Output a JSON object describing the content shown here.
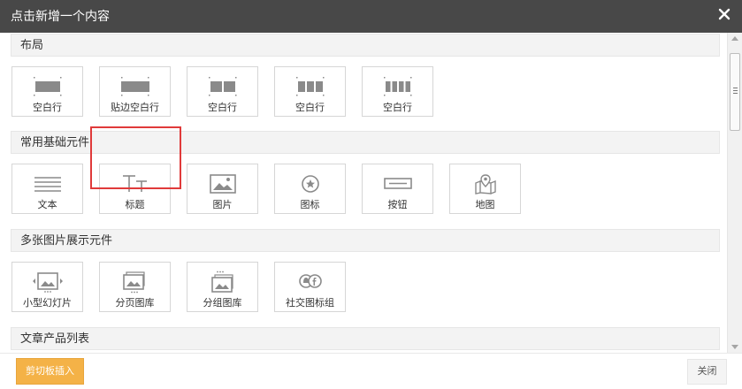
{
  "dialog": {
    "title": "点击新增一个内容"
  },
  "sections": [
    {
      "title": "布局",
      "items": [
        {
          "label": "空白行",
          "icon": "single-column-layout-icon"
        },
        {
          "label": "贴边空白行",
          "icon": "edge-column-layout-icon"
        },
        {
          "label": "空白行",
          "icon": "two-column-layout-icon"
        },
        {
          "label": "空白行",
          "icon": "three-column-layout-icon"
        },
        {
          "label": "空白行",
          "icon": "four-column-layout-icon"
        }
      ]
    },
    {
      "title": "常用基础元件",
      "items": [
        {
          "label": "文本",
          "icon": "text-lines-icon"
        },
        {
          "label": "标题",
          "icon": "title-tt-icon"
        },
        {
          "label": "图片",
          "icon": "image-icon"
        },
        {
          "label": "图标",
          "icon": "star-circle-icon"
        },
        {
          "label": "按钮",
          "icon": "button-icon"
        },
        {
          "label": "地图",
          "icon": "map-pin-icon"
        }
      ]
    },
    {
      "title": "多张图片展示元件",
      "items": [
        {
          "label": "小型幻灯片",
          "icon": "slideshow-icon"
        },
        {
          "label": "分页图库",
          "icon": "paged-gallery-icon"
        },
        {
          "label": "分组图库",
          "icon": "grouped-gallery-icon"
        },
        {
          "label": "社交图标组",
          "icon": "social-icons-icon"
        }
      ]
    },
    {
      "title": "文章产品列表",
      "items": []
    }
  ],
  "footer": {
    "clipboard_insert": "剪切板插入",
    "close": "关闭"
  },
  "colors": {
    "titlebar": "#484848",
    "accent_button": "#f4b247",
    "highlight": "#e03a3a"
  }
}
